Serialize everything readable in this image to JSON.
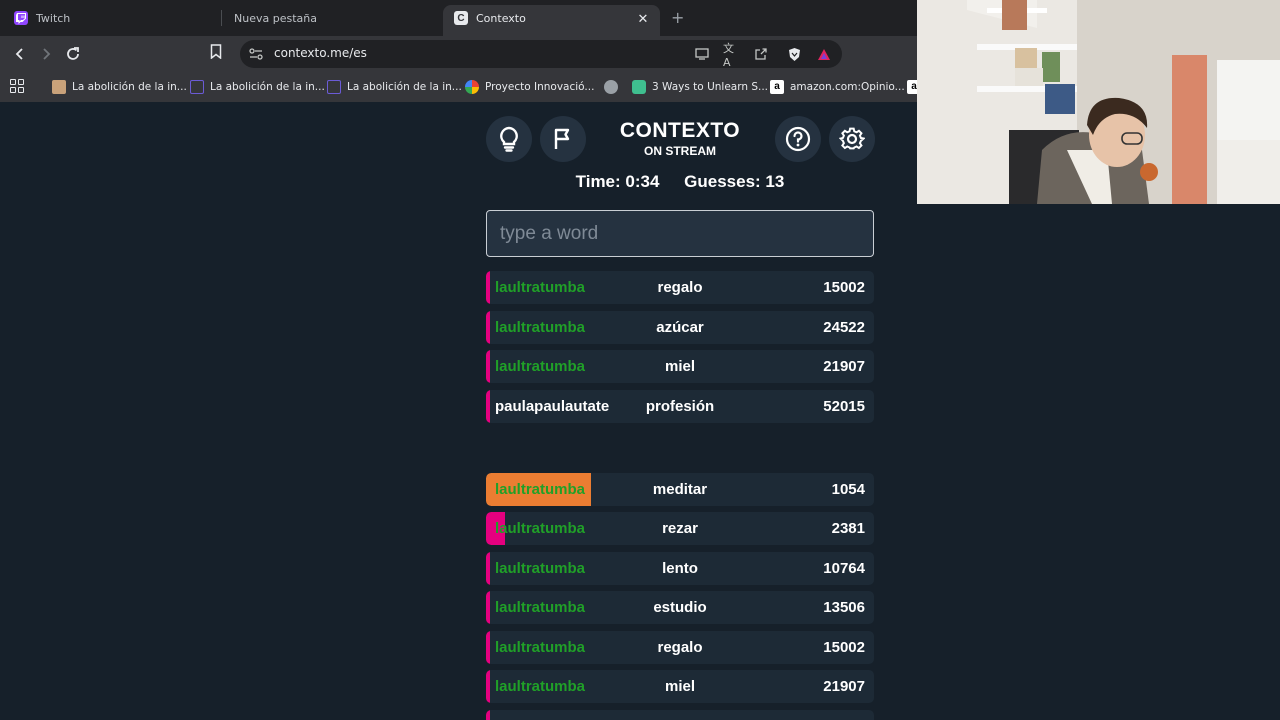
{
  "browser": {
    "tabs": [
      {
        "label": "Twitch",
        "icon": "twitch-icon"
      },
      {
        "label": "Nueva pestaña",
        "icon": "none"
      },
      {
        "label": "Contexto",
        "icon": "contexto-icon",
        "icon_letter": "C",
        "active": true
      }
    ],
    "url": "contexto.me/es",
    "bookmarks": [
      {
        "label": "La abolición de la in...",
        "color": "#c9a27a"
      },
      {
        "label": "La abolición de la in...",
        "color": "#6b5bd6"
      },
      {
        "label": "La abolición de la in...",
        "color": "#6b5bd6"
      },
      {
        "label": "Proyecto Innovació...",
        "color": "#e0b020"
      },
      {
        "label": "",
        "color": "#9aa0a6"
      },
      {
        "label": "3 Ways to Unlearn S...",
        "color": "#3fbf8f"
      },
      {
        "label": "amazon.com:Opinio...",
        "color": "#ffffff"
      },
      {
        "label": "a",
        "color": "#ffffff"
      }
    ]
  },
  "game": {
    "title": "CONTEXTO",
    "subtitle": "ON STREAM",
    "time_label": "Time: 0:34",
    "guesses_label": "Guesses: 13",
    "input_placeholder": "type a word",
    "recent_guesses": [
      {
        "user": "laultratumba",
        "word": "regalo",
        "rank": "15002",
        "user_color": "green",
        "bar": 0.01
      },
      {
        "user": "laultratumba",
        "word": "azúcar",
        "rank": "24522",
        "user_color": "green",
        "bar": 0.01
      },
      {
        "user": "laultratumba",
        "word": "miel",
        "rank": "21907",
        "user_color": "green",
        "bar": 0.01
      },
      {
        "user": "paulapaulautate",
        "word": "profesión",
        "rank": "52015",
        "user_color": "white",
        "bar": 0.01
      }
    ],
    "ranked_guesses": [
      {
        "user": "laultratumba",
        "word": "meditar",
        "rank": "1054",
        "user_color": "green",
        "bar": 0.27,
        "bar_color": "#eb7d32"
      },
      {
        "user": "laultratumba",
        "word": "rezar",
        "rank": "2381",
        "user_color": "green",
        "bar": 0.05,
        "bar_color": "#e5007f"
      },
      {
        "user": "laultratumba",
        "word": "lento",
        "rank": "10764",
        "user_color": "green",
        "bar": 0.01,
        "bar_color": "#e5007f"
      },
      {
        "user": "laultratumba",
        "word": "estudio",
        "rank": "13506",
        "user_color": "green",
        "bar": 0.01,
        "bar_color": "#e5007f"
      },
      {
        "user": "laultratumba",
        "word": "regalo",
        "rank": "15002",
        "user_color": "green",
        "bar": 0.01,
        "bar_color": "#e5007f"
      },
      {
        "user": "laultratumba",
        "word": "miel",
        "rank": "21907",
        "user_color": "green",
        "bar": 0.01,
        "bar_color": "#e5007f"
      }
    ]
  },
  "colors": {
    "page_bg": "#16202a",
    "row_bg": "#1d2a36",
    "accent_pink": "#e5007f",
    "accent_orange": "#eb7d32",
    "user_green": "#20a028"
  }
}
